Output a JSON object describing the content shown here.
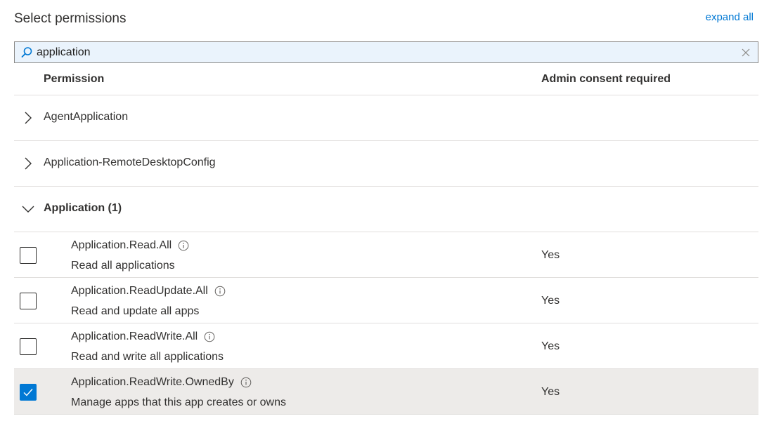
{
  "header": {
    "title": "Select permissions",
    "expand_all_label": "expand all"
  },
  "search": {
    "value": "application",
    "icon": "search-icon",
    "clear_icon": "close-icon"
  },
  "columns": {
    "permission": "Permission",
    "admin_consent": "Admin consent required"
  },
  "groups": [
    {
      "label": "AgentApplication",
      "expanded": false
    },
    {
      "label": "Application-RemoteDesktopConfig",
      "expanded": false
    },
    {
      "label": "Application (1)",
      "expanded": true
    }
  ],
  "permissions": [
    {
      "name": "Application.Read.All",
      "description": "Read all applications",
      "admin": "Yes",
      "checked": false
    },
    {
      "name": "Application.ReadUpdate.All",
      "description": "Read and update all apps",
      "admin": "Yes",
      "checked": false
    },
    {
      "name": "Application.ReadWrite.All",
      "description": "Read and write all applications",
      "admin": "Yes",
      "checked": false
    },
    {
      "name": "Application.ReadWrite.OwnedBy",
      "description": "Manage apps that this app creates or owns",
      "admin": "Yes",
      "checked": true
    }
  ],
  "colors": {
    "accent": "#0078d4",
    "selected_row": "#edebe9",
    "search_bg": "#eaf3fc"
  }
}
